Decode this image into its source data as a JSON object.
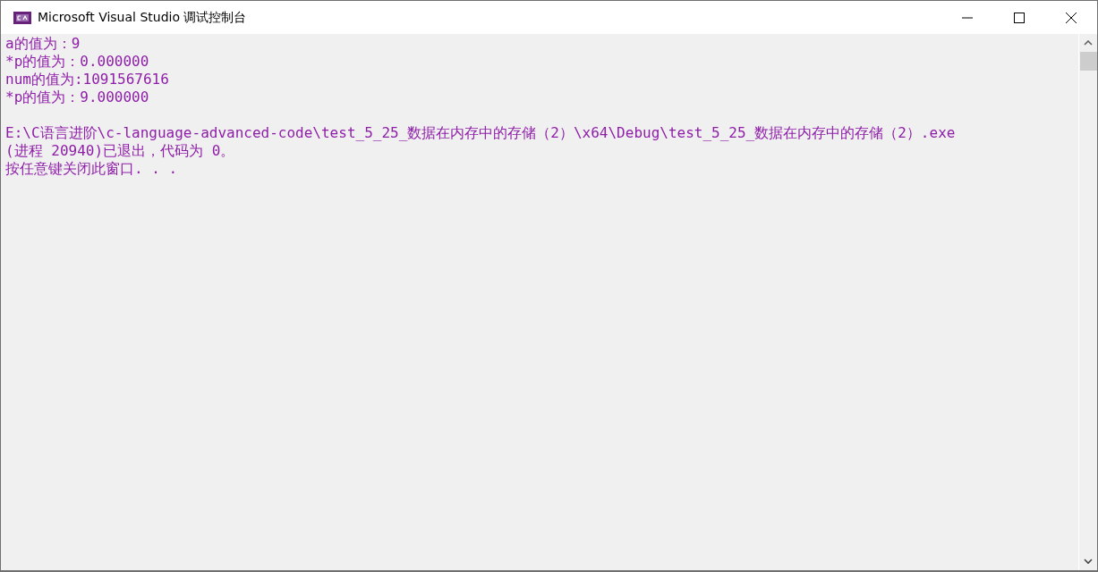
{
  "window": {
    "title": "Microsoft Visual Studio 调试控制台"
  },
  "console": {
    "blocks": [
      [
        "a的值为：9",
        "*p的值为：0.000000",
        "num的值为:1091567616",
        "*p的值为：9.000000"
      ],
      [
        "E:\\C语言进阶\\c-language-advanced-code\\test_5_25_数据在内存中的存储（2）\\x64\\Debug\\test_5_25_数据在内存中的存储（2）.exe",
        "(进程 20940)已退出，代码为 0。",
        "按任意键关闭此窗口. . ."
      ]
    ]
  }
}
